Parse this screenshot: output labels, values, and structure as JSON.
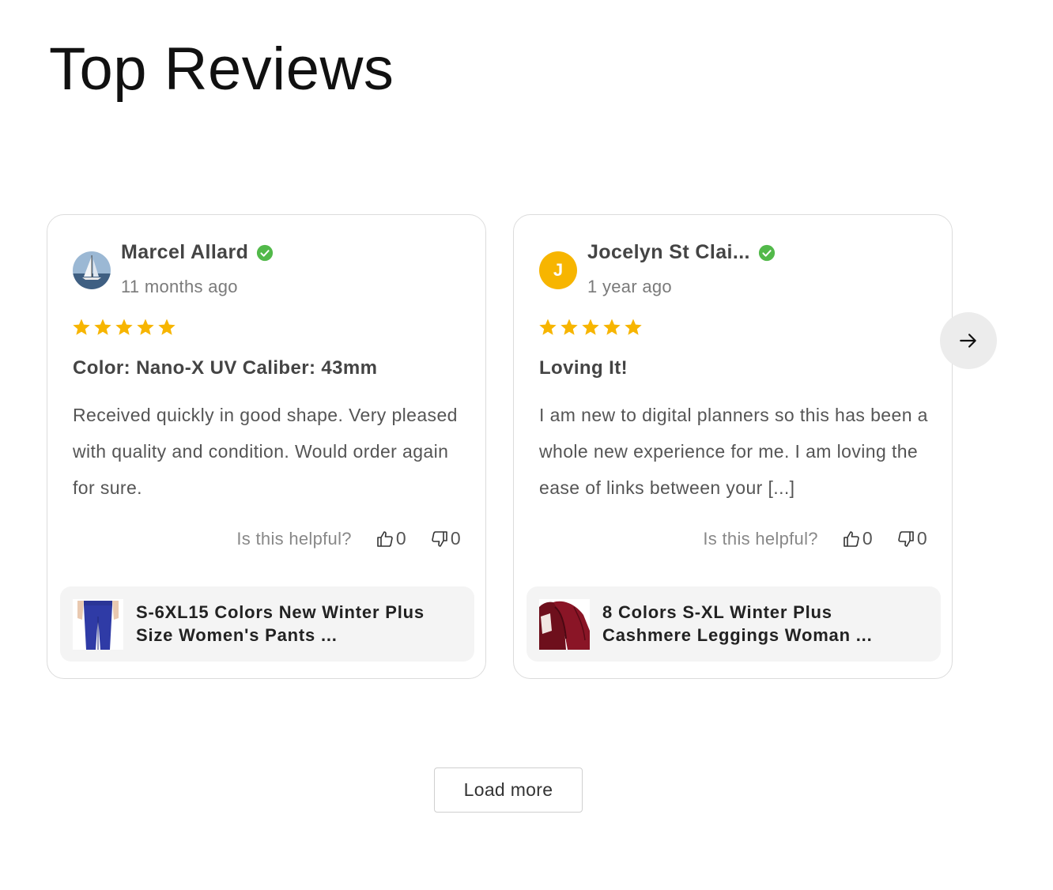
{
  "page_title": "Top Reviews",
  "colors": {
    "star": "#f7b500",
    "verified": "#52b94a",
    "avatar_letter_bg": "#f7b500"
  },
  "reviews": [
    {
      "author": "Marcel Allard",
      "avatar_type": "image-sailboat",
      "verified": true,
      "date": "11 months ago",
      "rating": 5,
      "title": "Color: Nano-X UV Caliber: 43mm",
      "body": "Received quickly in good shape. Very pleased with quality and condition. Would order again for sure.",
      "helpful_label": "Is this helpful?",
      "upvotes": "0",
      "downvotes": "0",
      "product": {
        "title": "S-6XL15 Colors New Winter Plus Size Women's Pants ...",
        "thumb": "blue-leggings"
      }
    },
    {
      "author": "Jocelyn St Clai...",
      "avatar_letter": "J",
      "verified": true,
      "date": "1 year ago",
      "rating": 5,
      "title": "Loving It!",
      "body": "I am new to digital planners so this has been a whole new experience for me. I am loving the ease of links between your [...]",
      "helpful_label": "Is this helpful?",
      "upvotes": "0",
      "downvotes": "0",
      "product": {
        "title": "8 Colors S-XL Winter Plus Cashmere Leggings Woman ...",
        "thumb": "burgundy-leggings"
      }
    }
  ],
  "next_icon": "arrow-right-icon",
  "load_more_label": "Load more"
}
